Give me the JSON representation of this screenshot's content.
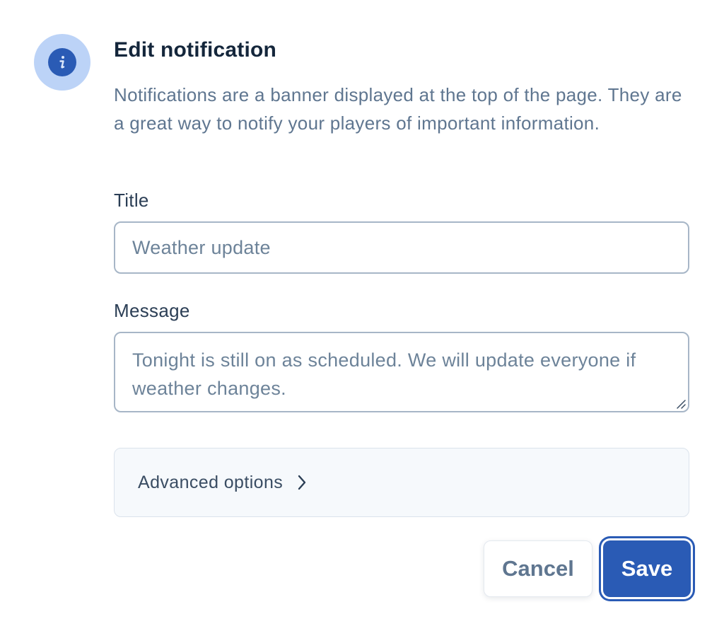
{
  "dialog": {
    "title": "Edit notification",
    "description": "Notifications are a banner displayed at the top of the page. They are a great way to notify your players of important information.",
    "icon": "info-icon"
  },
  "form": {
    "title_label": "Title",
    "title_value": "Weather update",
    "message_label": "Message",
    "message_value": "Tonight is still on as scheduled. We will update everyone if weather changes."
  },
  "advanced": {
    "label": "Advanced options",
    "icon": "chevron-right-icon"
  },
  "actions": {
    "cancel_label": "Cancel",
    "save_label": "Save"
  },
  "colors": {
    "primary": "#2a5bb5",
    "icon_halo": "#bcd3f7",
    "heading": "#14263b",
    "body_text": "#5f7690"
  }
}
